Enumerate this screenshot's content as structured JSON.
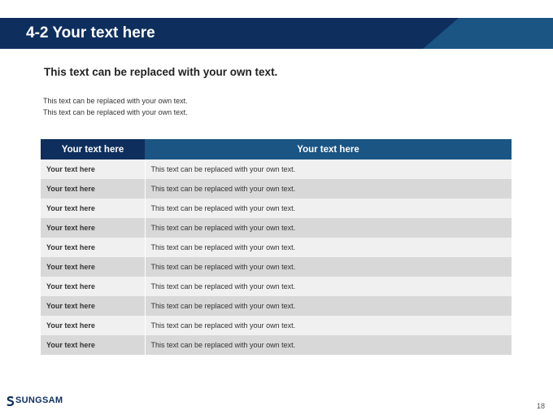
{
  "header": {
    "title": "4-2 Your text here",
    "colors": {
      "dark": "#0e2f5e",
      "accent": "#1a5584"
    }
  },
  "content": {
    "subtitle": "This text can be replaced with your own text.",
    "description": [
      "This text can be replaced with your own text.",
      "This text can be replaced with your own text."
    ]
  },
  "table": {
    "headers": [
      "Your text here",
      "Your text here"
    ],
    "rows": [
      [
        "Your text here",
        "This text can be replaced with your own text."
      ],
      [
        "Your text here",
        "This text can be replaced with your own text."
      ],
      [
        "Your text here",
        "This text can be replaced with your own text."
      ],
      [
        "Your text here",
        "This text can be replaced with your own text."
      ],
      [
        "Your text here",
        "This text can be replaced with your own text."
      ],
      [
        "Your text here",
        "This text can be replaced with your own text."
      ],
      [
        "Your text here",
        "This text can be replaced with your own text."
      ],
      [
        "Your text here",
        "This text can be replaced with your own text."
      ],
      [
        "Your text here",
        "This text can be replaced with your own text."
      ],
      [
        "Your text here",
        "This text can be replaced with your own text."
      ]
    ]
  },
  "footer": {
    "logo_text": "SUNGSAM",
    "logo_icon": "sungsam-logo-icon",
    "page_number": "18"
  }
}
